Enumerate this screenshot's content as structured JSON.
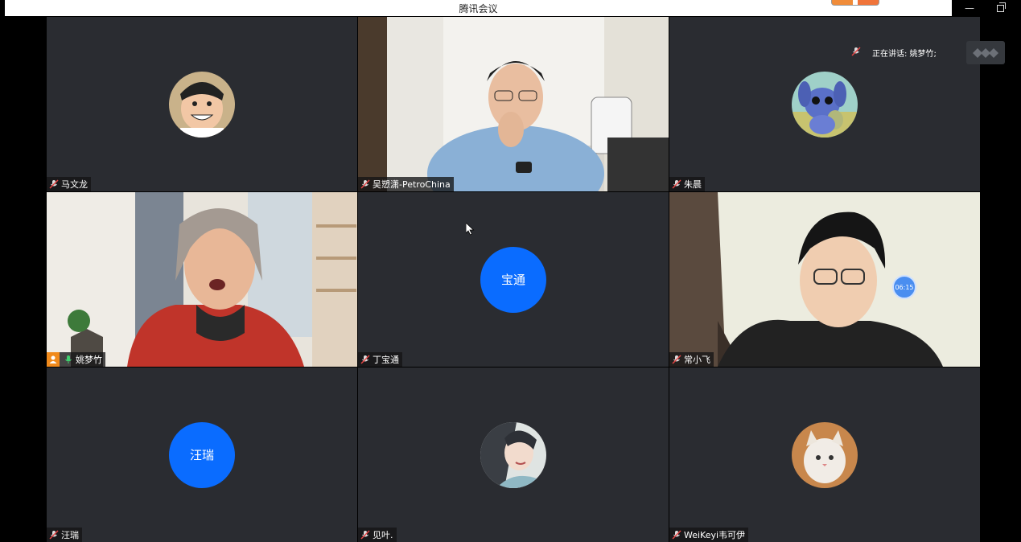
{
  "window": {
    "title": "腾讯会议"
  },
  "speaking_indicator": {
    "label": "正在讲话: 姚梦竹;"
  },
  "timer": "06:15",
  "participants": [
    {
      "name": "马文龙",
      "display": "avatar",
      "avatar_icon": "cartoon-boy-avatar-icon"
    },
    {
      "name": "吴愬潇-PetroChina",
      "display": "video"
    },
    {
      "name": "朱晨",
      "display": "avatar",
      "avatar_icon": "blue-alien-avatar-icon"
    },
    {
      "name": "姚梦竹",
      "display": "video",
      "host": true,
      "speaking": true
    },
    {
      "name": "丁宝通",
      "display": "name-avatar",
      "avatar_text": "宝通"
    },
    {
      "name": "常小飞",
      "display": "video"
    },
    {
      "name": "汪瑞",
      "display": "name-avatar",
      "avatar_text": "汪瑞"
    },
    {
      "name": "见叶.",
      "display": "avatar",
      "avatar_icon": "girl-illustration-avatar-icon"
    },
    {
      "name": "WeiKeyi韦可伊",
      "display": "avatar",
      "avatar_icon": "cat-avatar-icon"
    }
  ],
  "colors": {
    "tile_bg": "#2a2c31",
    "name_avatar_bg": "#0a6cff",
    "host_badge": "#f08a1c",
    "active_border": "#3fb07a"
  }
}
